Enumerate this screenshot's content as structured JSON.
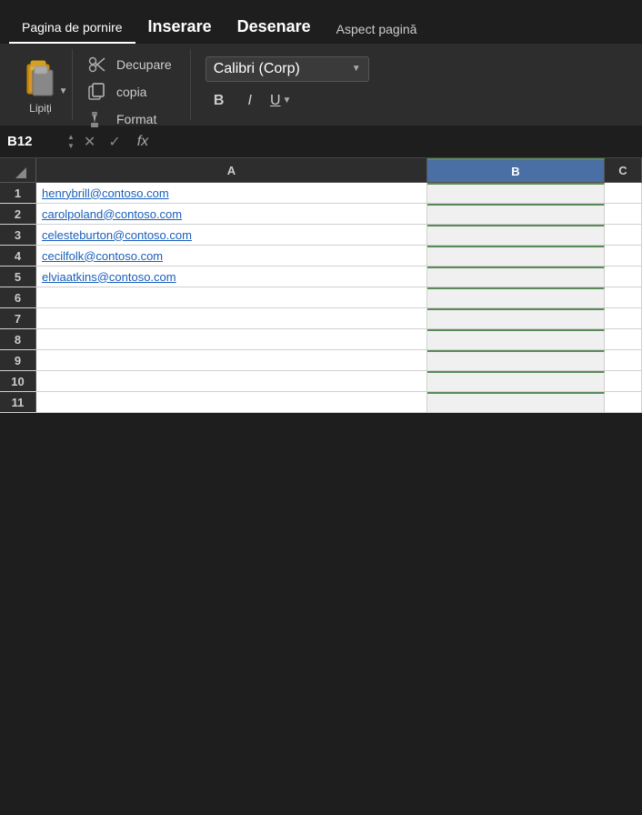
{
  "tabs": [
    {
      "label": "Pagina de pornire",
      "active": true,
      "large": false
    },
    {
      "label": "Inserare",
      "active": false,
      "large": true
    },
    {
      "label": "Desenare",
      "active": false,
      "large": true
    },
    {
      "label": "Aspect pagină",
      "active": false,
      "large": false
    }
  ],
  "ribbon": {
    "paste_label": "Lipiți",
    "font_name": "Calibri (Corp)",
    "bold_label": "B",
    "italic_label": "I",
    "underline_label": "U"
  },
  "clipboard_menu": [
    {
      "id": "decupare",
      "label": "Decupare",
      "icon": "✂"
    },
    {
      "id": "copia",
      "label": "copia",
      "icon": "⧉"
    },
    {
      "id": "format",
      "label": "Format",
      "icon": "🖌"
    }
  ],
  "formula_bar": {
    "cell_ref": "B12",
    "fx_label": "fx"
  },
  "grid": {
    "col_headers": [
      "A",
      "B",
      "C"
    ],
    "rows": [
      {
        "num": 1,
        "a": "henrybrill@contoso.com",
        "b": "",
        "c": ""
      },
      {
        "num": 2,
        "a": "carolpoland@contoso.com",
        "b": "",
        "c": ""
      },
      {
        "num": 3,
        "a": "celesteburton@contoso.com",
        "b": "",
        "c": ""
      },
      {
        "num": 4,
        "a": "cecilfolk@contoso.com",
        "b": "",
        "c": ""
      },
      {
        "num": 5,
        "a": "elviaatkins@contoso.com",
        "b": "",
        "c": ""
      },
      {
        "num": 6,
        "a": "",
        "b": "",
        "c": ""
      },
      {
        "num": 7,
        "a": "",
        "b": "",
        "c": ""
      },
      {
        "num": 8,
        "a": "",
        "b": "",
        "c": ""
      },
      {
        "num": 9,
        "a": "",
        "b": "",
        "c": ""
      },
      {
        "num": 10,
        "a": "",
        "b": "",
        "c": ""
      },
      {
        "num": 11,
        "a": "",
        "b": "",
        "c": ""
      }
    ]
  },
  "colors": {
    "background": "#1e1e1e",
    "ribbon_bg": "#2d2d2d",
    "active_col": "#4a6fa5",
    "link_color": "#1a5fba"
  }
}
